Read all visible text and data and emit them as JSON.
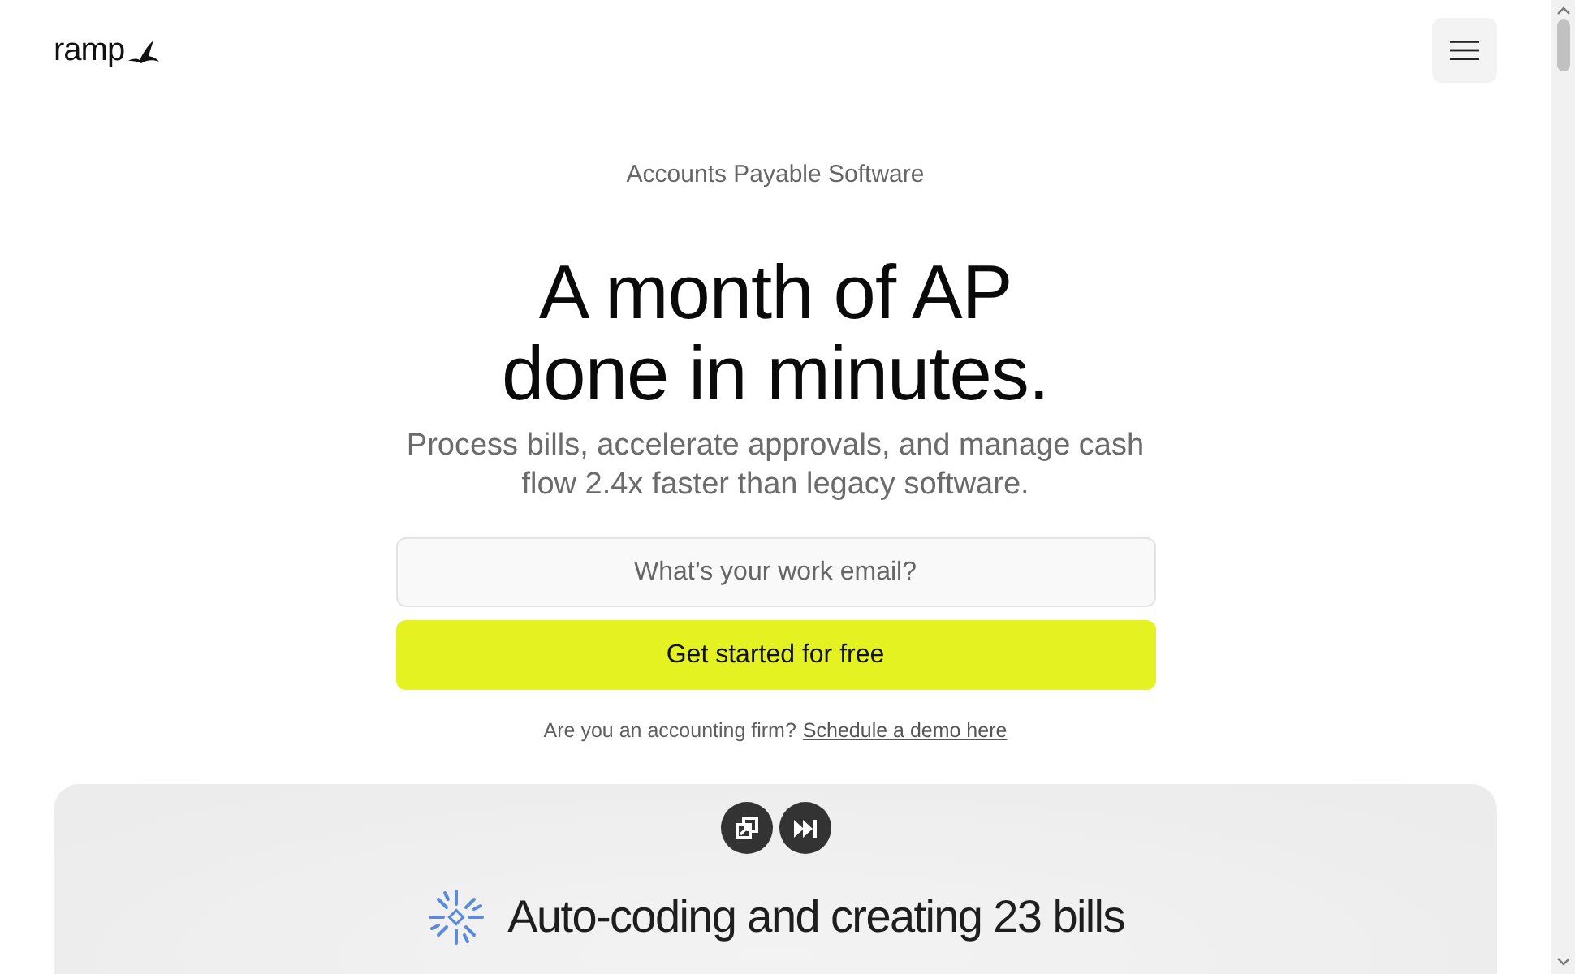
{
  "header": {
    "logo": "ramp"
  },
  "eyebrow": "Accounts Payable Software",
  "headline": [
    "A month of AP",
    "done in minutes."
  ],
  "subtitle": "Process bills, accelerate approvals, and manage cash flow 2.4x faster than legacy software.",
  "email_field": {
    "placeholder": "What’s your work email?"
  },
  "cta_button": "Get started for free",
  "note": {
    "text": "Are you an accounting firm?",
    "link": "Schedule a demo here"
  },
  "demo_card": {
    "status": "Auto-coding and creating 23 bills"
  }
}
